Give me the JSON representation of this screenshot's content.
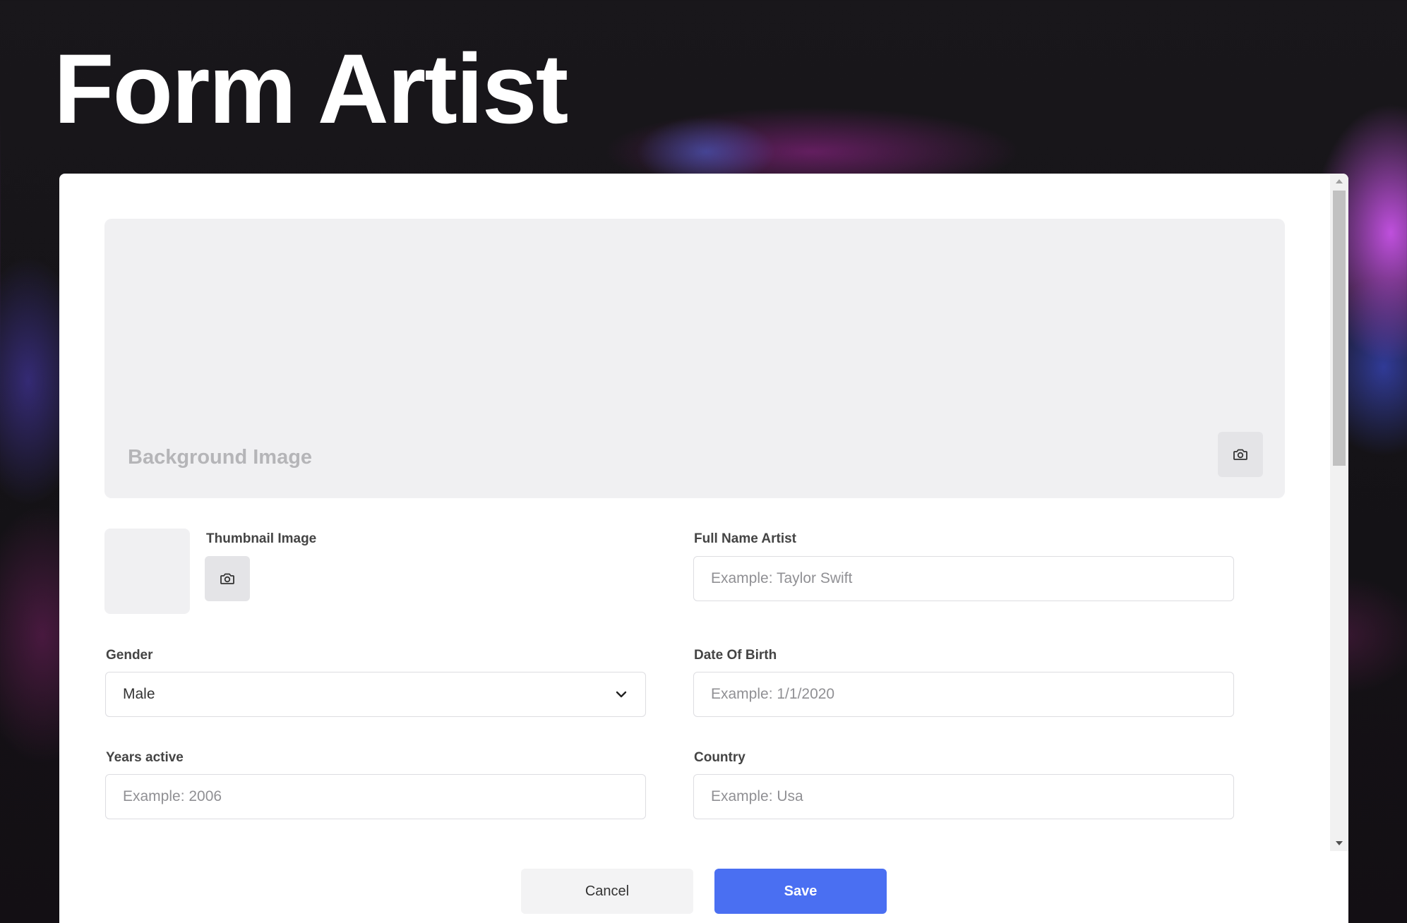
{
  "page": {
    "title": "Form Artist"
  },
  "form": {
    "background_image": {
      "label": "Background Image",
      "upload_icon": "camera-icon"
    },
    "thumbnail": {
      "label": "Thumbnail Image",
      "upload_icon": "camera-icon"
    },
    "full_name": {
      "label": "Full Name Artist",
      "value": "",
      "placeholder": "Example: Taylor Swift"
    },
    "gender": {
      "label": "Gender",
      "selected": "Male",
      "icon": "chevron-down-icon"
    },
    "date_of_birth": {
      "label": "Date Of Birth",
      "value": "",
      "placeholder": "Example: 1/1/2020"
    },
    "years_active": {
      "label": "Years active",
      "value": "",
      "placeholder": "Example: 2006"
    },
    "country": {
      "label": "Country",
      "value": "",
      "placeholder": "Example: Usa"
    }
  },
  "footer": {
    "cancel_label": "Cancel",
    "save_label": "Save"
  },
  "colors": {
    "accent": "#4a6ff2",
    "card_bg": "#ffffff",
    "placeholder_bg": "#f0f0f2"
  }
}
